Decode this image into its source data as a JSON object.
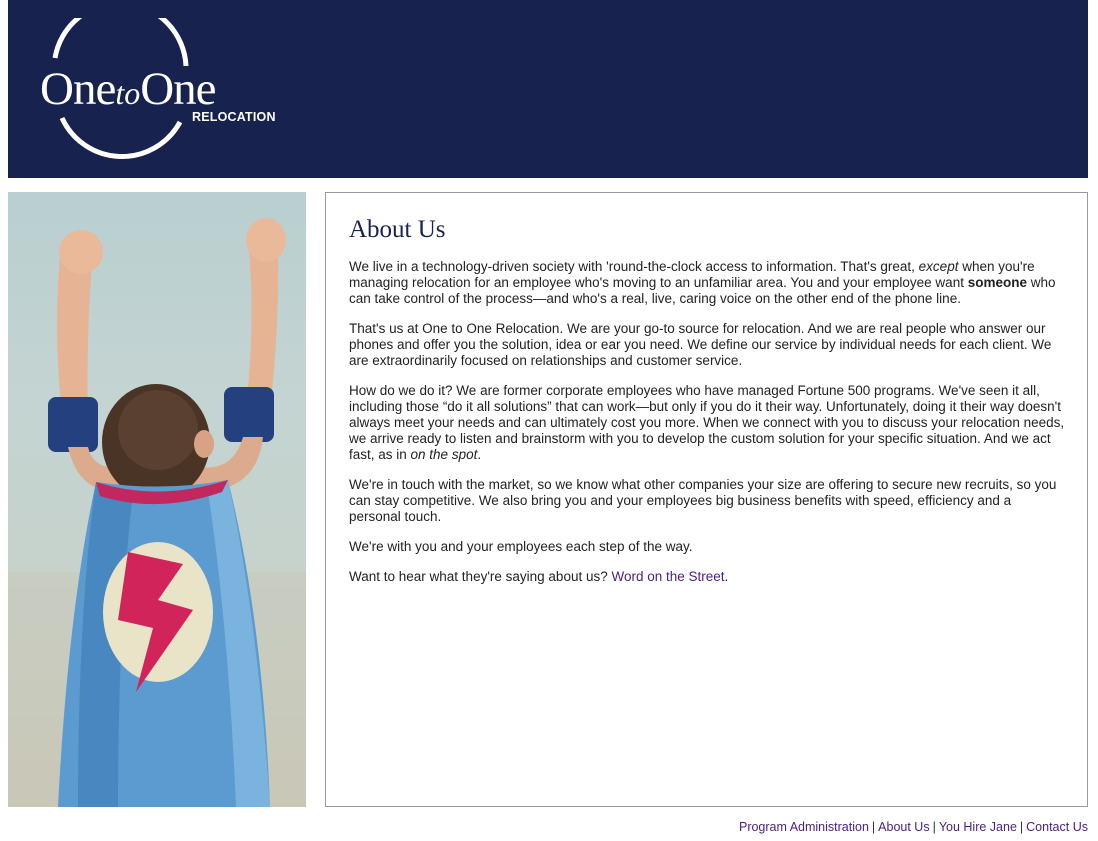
{
  "brand": {
    "logo_main_a": "One",
    "logo_main_b": "to",
    "logo_main_c": "One",
    "logo_sub": "RELOCATION",
    "header_color": "#17224e"
  },
  "hero": {
    "icon": "superhero-boy-with-cape-image"
  },
  "content": {
    "title": "About Us",
    "p1": {
      "a": "We live in a technology-driven society with 'round-the-clock access to information. That's great, ",
      "b_italic": "except",
      "c": " when you're managing relocation for an employee who's moving to an unfamiliar area. You and your employee want ",
      "d_bold": "someone",
      "e": " who can take control of the process—and who's a real, live, caring voice on the other end of the phone line."
    },
    "p2": "That's us at One to One Relocation. We are your go-to source for relocation. And we are real people who answer our phones and offer you the solution, idea or ear you need. We define our service by individual needs for each client. We are extraordinarily focused on relationships and customer service.",
    "p3": {
      "a": "How do we do it? We are former corporate employees who have managed Fortune 500 programs. We've seen it all, including those “do it all solutions” that can work—but only if you do it their way. Unfortunately, doing it their way doesn't always meet your needs and can ultimately cost you more. When we connect with you to discuss your relocation needs, we arrive ready to listen and brainstorm with you to develop the custom solution for your specific situation. And we act fast, as in ",
      "b_italic": "on the spot",
      "c": "."
    },
    "p4": "We're in touch with the market, so we know what other companies your size are offering to secure new recruits, so you can stay competitive. We also bring you and your employees big business benefits with speed, efficiency and a personal touch.",
    "p5": "We're with you and your employees each step of the way.",
    "p6": {
      "a": "Want to hear what they're saying about us? ",
      "link": "Word on the Street",
      "c": "."
    },
    "link_color": "#4b1f7d"
  },
  "footer": {
    "links": [
      "Program Administration",
      "About Us",
      "You Hire Jane",
      "Contact Us"
    ],
    "separator": "|"
  }
}
